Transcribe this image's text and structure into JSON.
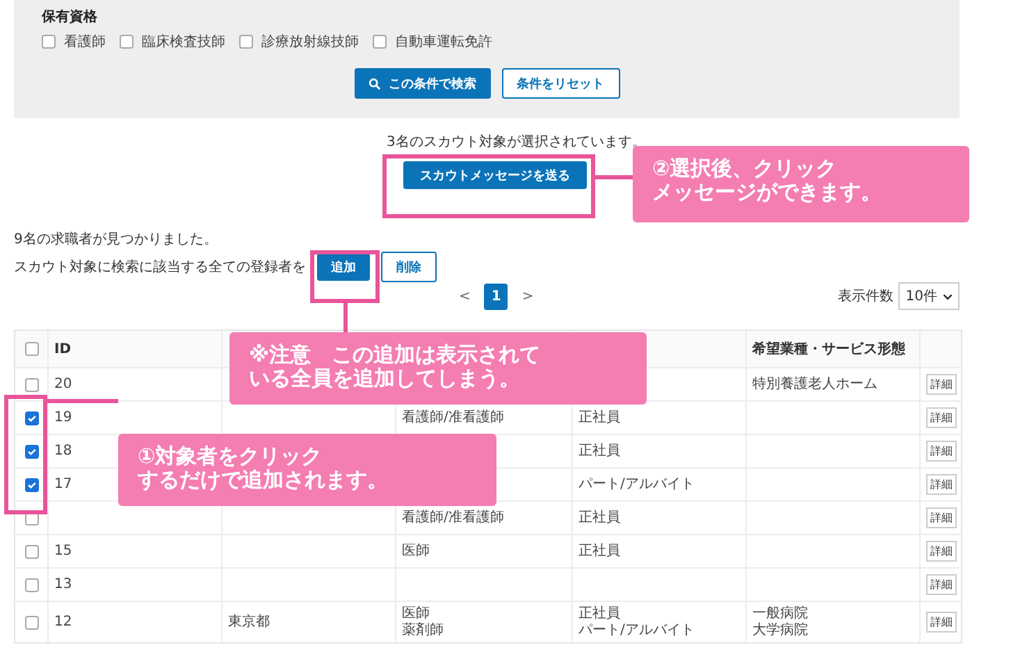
{
  "qualifications": {
    "label": "保有資格",
    "options": [
      {
        "label": "看護師",
        "checked": false
      },
      {
        "label": "臨床検査技師",
        "checked": false
      },
      {
        "label": "診療放射線技師",
        "checked": false
      },
      {
        "label": "自動車運転免許",
        "checked": false
      }
    ]
  },
  "search_button": "この条件で検索",
  "reset_button": "条件をリセット",
  "selected_notice": "3名のスカウト対象が選択されています。",
  "scout_button": "スカウトメッセージを送る",
  "result_count": "9名の求職者が見つかりました。",
  "bulk_label": "スカウト対象に検索に該当する全ての登録者を",
  "add_button": "追加",
  "remove_button": "削除",
  "pagination": {
    "prev": "<",
    "pages": [
      {
        "label": "1",
        "selected": true
      }
    ],
    "next": ">"
  },
  "page_size": {
    "label": "表示件数",
    "value": "10件"
  },
  "table": {
    "header_checked": false,
    "header": {
      "id": "ID",
      "column_6": "希望業種・サービス形態"
    },
    "rows": [
      {
        "checked": false,
        "id": [
          "20"
        ],
        "column_6": [
          "特別養護老人ホーム"
        ],
        "detail": "詳細"
      },
      {
        "checked": true,
        "id": [
          "19"
        ],
        "column_4": [
          "看護師/准看護師"
        ],
        "column_5": [
          "正社員"
        ],
        "detail": "詳細"
      },
      {
        "checked": true,
        "id": [
          "18"
        ],
        "column_5": [
          "正社員"
        ],
        "detail": "詳細"
      },
      {
        "checked": true,
        "id": [
          "17"
        ],
        "column_5": [
          "パート/アルバイト"
        ],
        "detail": "詳細"
      },
      {
        "checked": false,
        "column_4": [
          "看護師/准看護師"
        ],
        "column_5": [
          "正社員"
        ],
        "detail": "詳細"
      },
      {
        "checked": false,
        "id": [
          "15"
        ],
        "column_4": [
          "医師"
        ],
        "column_5": [
          "正社員"
        ],
        "detail": "詳細"
      },
      {
        "checked": false,
        "id": [
          "13"
        ],
        "detail": "詳細"
      },
      {
        "checked": false,
        "id": [
          "12"
        ],
        "column_3": [
          "東京都"
        ],
        "column_4": [
          "医師",
          "薬剤師"
        ],
        "column_5": [
          "正社員",
          "パート/アルバイト"
        ],
        "column_6": [
          "一般病院",
          "大学病院"
        ],
        "detail": "詳細"
      }
    ]
  },
  "callouts": [
    {
      "lines": [
        "②選択後、クリック",
        "メッセージができます。"
      ]
    },
    {
      "lines": [
        "※注意　この追加は表示されて",
        "いる全員を追加してしまう。"
      ]
    },
    {
      "lines": [
        "①対象者をクリック",
        "するだけで追加されます。"
      ]
    }
  ]
}
